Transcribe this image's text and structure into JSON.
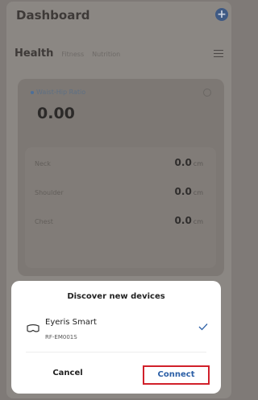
{
  "header": {
    "title": "Dashboard",
    "add_symbol": "+"
  },
  "tabs": {
    "active": "Health",
    "items": [
      "Fitness",
      "Nutrition"
    ]
  },
  "metric": {
    "label": "Waist-Hip Ratio",
    "value": "0.00"
  },
  "measurements": [
    {
      "label": "Neck",
      "value": "0.0",
      "unit": "cm"
    },
    {
      "label": "Shoulder",
      "value": "0.0",
      "unit": "cm"
    },
    {
      "label": "Chest",
      "value": "0.0",
      "unit": "cm"
    }
  ],
  "dialog": {
    "title": "Discover new devices",
    "device": {
      "name": "Eyeris Smart",
      "id": "RF-EM001S",
      "icon": "vr-headset-icon"
    },
    "cancel_label": "Cancel",
    "connect_label": "Connect",
    "accent": "#2b5fa6",
    "highlight": "#d1202a"
  }
}
